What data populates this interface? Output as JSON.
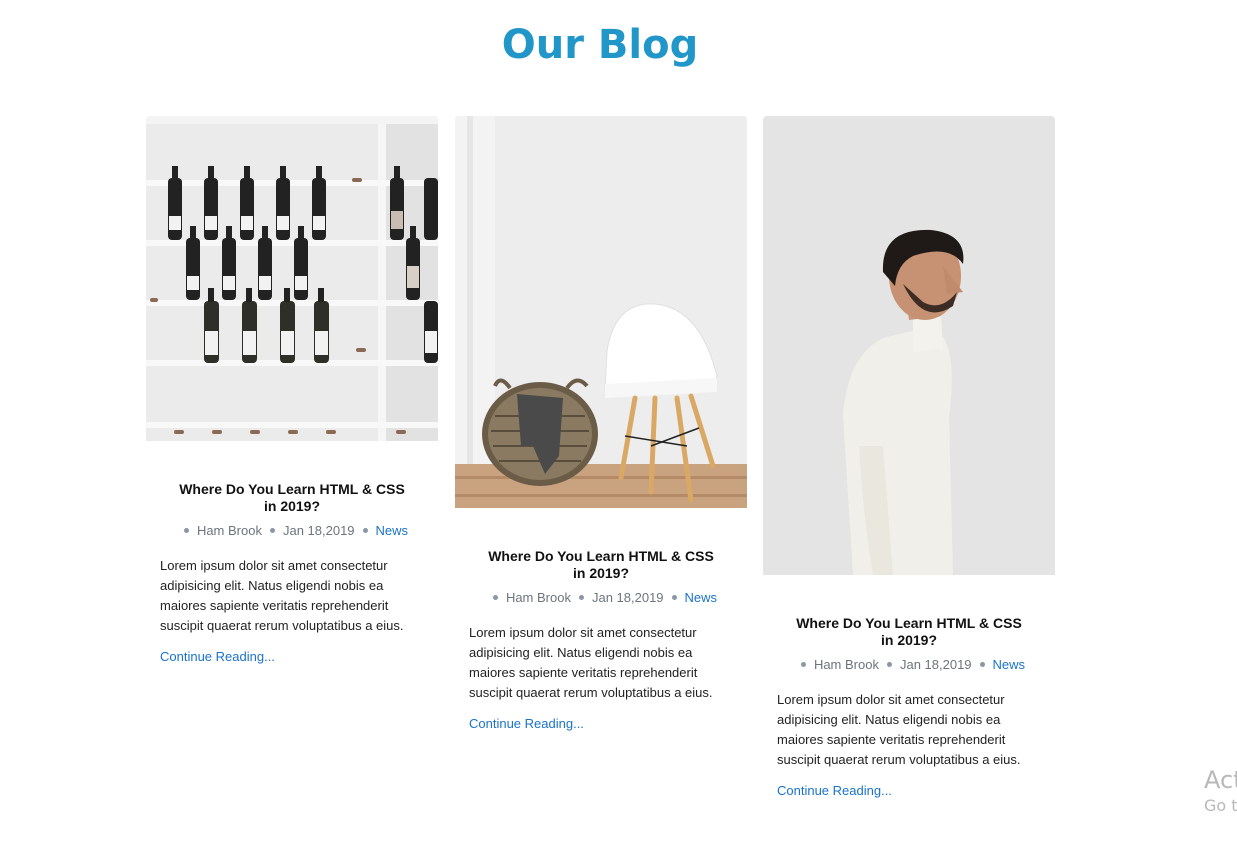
{
  "page": {
    "title": "Our Blog"
  },
  "posts": [
    {
      "title": "Where Do You Learn HTML & CSS in 2019?",
      "author": "Ham Brook",
      "date": "Jan 18,2019",
      "category": "News",
      "excerpt": "Lorem ipsum dolor sit amet consectetur adipisicing elit. Natus eligendi nobis ea maiores sapiente veritatis reprehenderit suscipit quaerat rerum voluptatibus a eius.",
      "link_text": "Continue Reading..."
    },
    {
      "title": "Where Do You Learn HTML & CSS in 2019?",
      "author": "Ham Brook",
      "date": "Jan 18,2019",
      "category": "News",
      "excerpt": "Lorem ipsum dolor sit amet consectetur adipisicing elit. Natus eligendi nobis ea maiores sapiente veritatis reprehenderit suscipit quaerat rerum voluptatibus a eius.",
      "link_text": "Continue Reading..."
    },
    {
      "title": "Where Do You Learn HTML & CSS in 2019?",
      "author": "Ham Brook",
      "date": "Jan 18,2019",
      "category": "News",
      "excerpt": "Lorem ipsum dolor sit amet consectetur adipisicing elit. Natus eligendi nobis ea maiores sapiente veritatis reprehenderit suscipit quaerat rerum voluptatibus a eius.",
      "link_text": "Continue Reading..."
    }
  ],
  "watermark": {
    "line1": "Act",
    "line2": "Go t"
  },
  "colors": {
    "title": "#2196c9",
    "link": "#1a73c9",
    "meta": "#6c757d"
  }
}
